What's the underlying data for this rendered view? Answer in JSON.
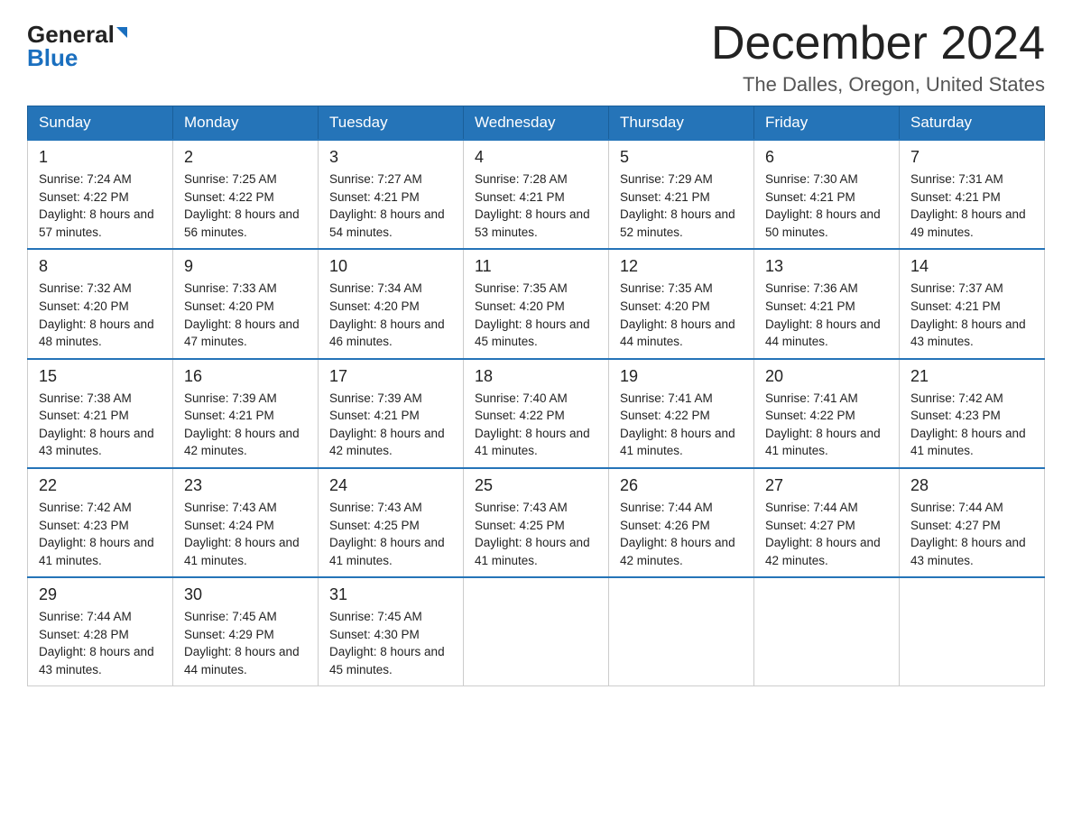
{
  "logo": {
    "general": "General",
    "blue": "Blue"
  },
  "title": "December 2024",
  "location": "The Dalles, Oregon, United States",
  "days_of_week": [
    "Sunday",
    "Monday",
    "Tuesday",
    "Wednesday",
    "Thursday",
    "Friday",
    "Saturday"
  ],
  "weeks": [
    [
      {
        "day": "1",
        "sunrise": "7:24 AM",
        "sunset": "4:22 PM",
        "daylight": "8 hours and 57 minutes."
      },
      {
        "day": "2",
        "sunrise": "7:25 AM",
        "sunset": "4:22 PM",
        "daylight": "8 hours and 56 minutes."
      },
      {
        "day": "3",
        "sunrise": "7:27 AM",
        "sunset": "4:21 PM",
        "daylight": "8 hours and 54 minutes."
      },
      {
        "day": "4",
        "sunrise": "7:28 AM",
        "sunset": "4:21 PM",
        "daylight": "8 hours and 53 minutes."
      },
      {
        "day": "5",
        "sunrise": "7:29 AM",
        "sunset": "4:21 PM",
        "daylight": "8 hours and 52 minutes."
      },
      {
        "day": "6",
        "sunrise": "7:30 AM",
        "sunset": "4:21 PM",
        "daylight": "8 hours and 50 minutes."
      },
      {
        "day": "7",
        "sunrise": "7:31 AM",
        "sunset": "4:21 PM",
        "daylight": "8 hours and 49 minutes."
      }
    ],
    [
      {
        "day": "8",
        "sunrise": "7:32 AM",
        "sunset": "4:20 PM",
        "daylight": "8 hours and 48 minutes."
      },
      {
        "day": "9",
        "sunrise": "7:33 AM",
        "sunset": "4:20 PM",
        "daylight": "8 hours and 47 minutes."
      },
      {
        "day": "10",
        "sunrise": "7:34 AM",
        "sunset": "4:20 PM",
        "daylight": "8 hours and 46 minutes."
      },
      {
        "day": "11",
        "sunrise": "7:35 AM",
        "sunset": "4:20 PM",
        "daylight": "8 hours and 45 minutes."
      },
      {
        "day": "12",
        "sunrise": "7:35 AM",
        "sunset": "4:20 PM",
        "daylight": "8 hours and 44 minutes."
      },
      {
        "day": "13",
        "sunrise": "7:36 AM",
        "sunset": "4:21 PM",
        "daylight": "8 hours and 44 minutes."
      },
      {
        "day": "14",
        "sunrise": "7:37 AM",
        "sunset": "4:21 PM",
        "daylight": "8 hours and 43 minutes."
      }
    ],
    [
      {
        "day": "15",
        "sunrise": "7:38 AM",
        "sunset": "4:21 PM",
        "daylight": "8 hours and 43 minutes."
      },
      {
        "day": "16",
        "sunrise": "7:39 AM",
        "sunset": "4:21 PM",
        "daylight": "8 hours and 42 minutes."
      },
      {
        "day": "17",
        "sunrise": "7:39 AM",
        "sunset": "4:21 PM",
        "daylight": "8 hours and 42 minutes."
      },
      {
        "day": "18",
        "sunrise": "7:40 AM",
        "sunset": "4:22 PM",
        "daylight": "8 hours and 41 minutes."
      },
      {
        "day": "19",
        "sunrise": "7:41 AM",
        "sunset": "4:22 PM",
        "daylight": "8 hours and 41 minutes."
      },
      {
        "day": "20",
        "sunrise": "7:41 AM",
        "sunset": "4:22 PM",
        "daylight": "8 hours and 41 minutes."
      },
      {
        "day": "21",
        "sunrise": "7:42 AM",
        "sunset": "4:23 PM",
        "daylight": "8 hours and 41 minutes."
      }
    ],
    [
      {
        "day": "22",
        "sunrise": "7:42 AM",
        "sunset": "4:23 PM",
        "daylight": "8 hours and 41 minutes."
      },
      {
        "day": "23",
        "sunrise": "7:43 AM",
        "sunset": "4:24 PM",
        "daylight": "8 hours and 41 minutes."
      },
      {
        "day": "24",
        "sunrise": "7:43 AM",
        "sunset": "4:25 PM",
        "daylight": "8 hours and 41 minutes."
      },
      {
        "day": "25",
        "sunrise": "7:43 AM",
        "sunset": "4:25 PM",
        "daylight": "8 hours and 41 minutes."
      },
      {
        "day": "26",
        "sunrise": "7:44 AM",
        "sunset": "4:26 PM",
        "daylight": "8 hours and 42 minutes."
      },
      {
        "day": "27",
        "sunrise": "7:44 AM",
        "sunset": "4:27 PM",
        "daylight": "8 hours and 42 minutes."
      },
      {
        "day": "28",
        "sunrise": "7:44 AM",
        "sunset": "4:27 PM",
        "daylight": "8 hours and 43 minutes."
      }
    ],
    [
      {
        "day": "29",
        "sunrise": "7:44 AM",
        "sunset": "4:28 PM",
        "daylight": "8 hours and 43 minutes."
      },
      {
        "day": "30",
        "sunrise": "7:45 AM",
        "sunset": "4:29 PM",
        "daylight": "8 hours and 44 minutes."
      },
      {
        "day": "31",
        "sunrise": "7:45 AM",
        "sunset": "4:30 PM",
        "daylight": "8 hours and 45 minutes."
      },
      null,
      null,
      null,
      null
    ]
  ]
}
